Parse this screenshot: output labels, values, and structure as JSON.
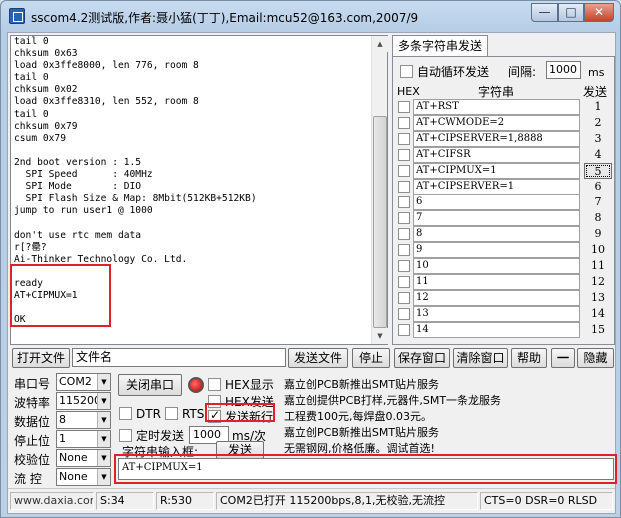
{
  "window": {
    "title": "sscom4.2测试版,作者:聂小猛(丁丁),Email:mcu52@163.com,2007/9"
  },
  "receive": {
    "lines": [
      "tail 0",
      "chksum 0x63",
      "load 0x3ffe8000, len 776, room 8",
      "tail 0",
      "chksum 0x02",
      "load 0x3ffe8310, len 552, room 8",
      "tail 0",
      "chksum 0x79",
      "csum 0x79",
      "",
      "2nd boot version : 1.5",
      "  SPI Speed      : 40MHz",
      "  SPI Mode       : DIO",
      "  SPI Flash Size & Map: 8Mbit(512KB+512KB)",
      "jump to run user1 @ 1000",
      "",
      "don't use rtc mem data",
      "r[?罍?",
      "Ai-Thinker Technology Co. Ltd.",
      "",
      "ready",
      "AT+CIPMUX=1",
      "",
      "OK"
    ]
  },
  "multi": {
    "tab_label": "多条字符串发送",
    "loop_label": "自动循环发送",
    "interval_label": "间隔:",
    "interval_value": "1000",
    "interval_unit": "ms",
    "hex_header": "HEX",
    "string_header": "字符串",
    "send_header": "发送",
    "rows": [
      {
        "text": "AT+RST",
        "btn": "1"
      },
      {
        "text": "AT+CWMODE=2",
        "btn": "2"
      },
      {
        "text": "AT+CIPSERVER=1,8888",
        "btn": "3"
      },
      {
        "text": "AT+CIFSR",
        "btn": "4"
      },
      {
        "text": "AT+CIPMUX=1",
        "btn": "5"
      },
      {
        "text": "AT+CIPSERVER=1",
        "btn": "6"
      },
      {
        "text": "6",
        "btn": "7"
      },
      {
        "text": "7",
        "btn": "8"
      },
      {
        "text": "8",
        "btn": "9"
      },
      {
        "text": "9",
        "btn": "10"
      },
      {
        "text": "10",
        "btn": "11"
      },
      {
        "text": "11",
        "btn": "12"
      },
      {
        "text": "12",
        "btn": "13"
      },
      {
        "text": "13",
        "btn": "14"
      },
      {
        "text": "14",
        "btn": "15"
      }
    ]
  },
  "toolbar": {
    "open_file": "打开文件",
    "filename_value": "文件名",
    "send_file": "发送文件",
    "stop": "停止",
    "save_window": "保存窗口",
    "clear_window": "清除窗口",
    "help": "帮助",
    "minus": "一",
    "hide": "隐藏"
  },
  "settings": {
    "port_label": "串口号",
    "port_value": "COM2",
    "baud_label": "波特率",
    "baud_value": "115200",
    "databits_label": "数据位",
    "databits_value": "8",
    "stopbits_label": "停止位",
    "stopbits_value": "1",
    "parity_label": "校验位",
    "parity_value": "None",
    "flow_label": "流 控",
    "flow_value": "None",
    "close_port": "关闭串口",
    "hex_display": "HEX显示",
    "hex_send": "HEX发送",
    "dtr": "DTR",
    "rts": "RTS",
    "send_newline": "发送新行",
    "timed_send": "定时发送",
    "timed_value": "1000",
    "timed_unit": "ms/次",
    "input_label": "字符串输入框:",
    "send_btn": "发送",
    "send_text": "AT+CIPMUX=1"
  },
  "ads": [
    "嘉立创PCB新推出SMT贴片服务",
    "嘉立创提供PCB打样,元器件,SMT一条龙服务",
    "工程费100元,每焊盘0.03元。",
    "嘉立创PCB新推出SMT贴片服务",
    "无需钢网,价格低廉。调试首选!"
  ],
  "status": {
    "site": "www.daxia.com",
    "s": "S:34",
    "r": "R:530",
    "port_info": "COM2已打开  115200bps,8,1,无校验,无流控",
    "lines": "CTS=0 DSR=0 RLSD"
  }
}
